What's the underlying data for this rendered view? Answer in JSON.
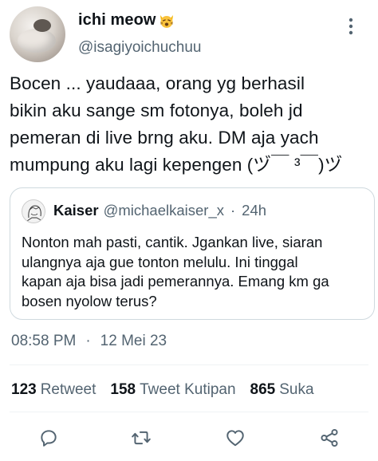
{
  "tweet": {
    "display_name": "ichi meow",
    "name_emoji_icon": "weary-cat-emoji-icon",
    "handle": "@isagiyoichuchuu",
    "text": "Bocen ... yaudaaa, orang yg berhasil\nbikin aku sange sm fotonya, boleh jd\npemeran di live brng aku. DM aja yach\nmumpung aku lagi kepengen (ヅ￣ ³￣)ヅ",
    "time": "08:58 PM",
    "date": "12 Mei 23"
  },
  "quoted_tweet": {
    "display_name": "Kaiser",
    "handle": "@michaelkaiser_x",
    "separator": "·",
    "age": "24h",
    "text": "Nonton mah pasti, cantik. Jgankan live, siaran\nulangnya aja gue tonton melulu. Ini tinggal\nkapan aja bisa jadi pemerannya. Emang km ga\nbosen nyolow terus?"
  },
  "stats": {
    "retweets": {
      "count": "123",
      "label": "Retweet"
    },
    "quotes": {
      "count": "158",
      "label": "Tweet Kutipan"
    },
    "likes": {
      "count": "865",
      "label": "Suka"
    }
  },
  "meta_separator": "·",
  "icons": {
    "more": "more-vertical-icon",
    "reply": "reply-icon",
    "retweet": "retweet-icon",
    "like": "heart-icon",
    "share": "share-icon"
  },
  "colors": {
    "primary_text": "#0f1419",
    "secondary_text": "#536471",
    "border": "#cfd9de",
    "icon": "#536471"
  }
}
